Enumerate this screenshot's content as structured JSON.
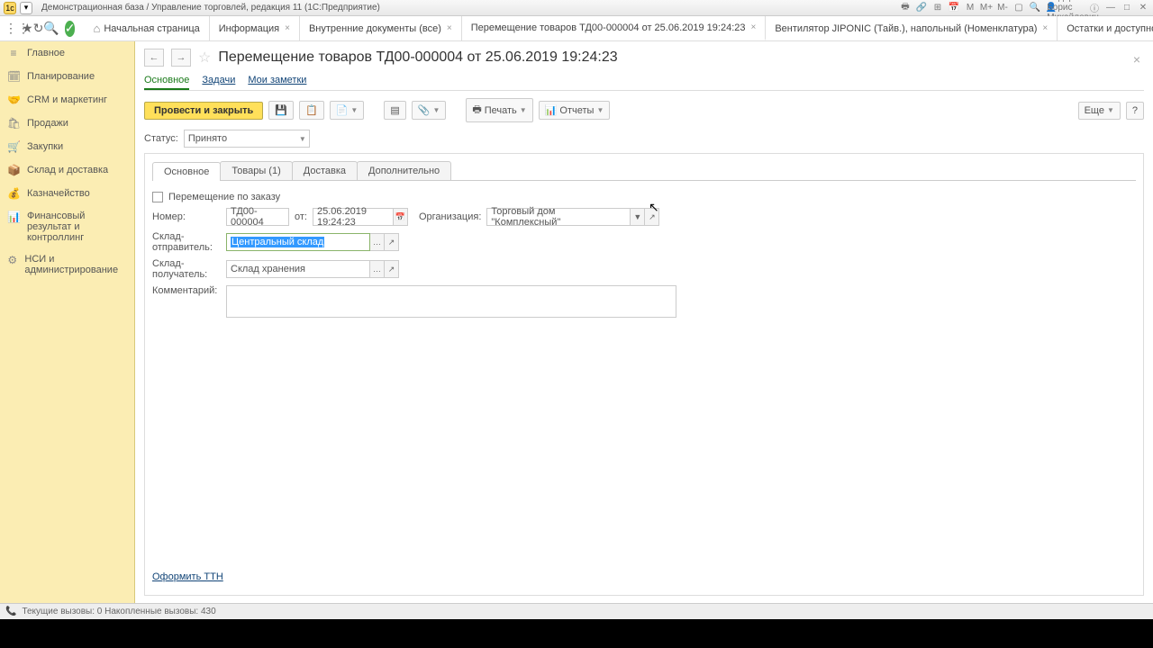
{
  "titlebar": {
    "title": "Демонстрационная база / Управление торговлей, редакция 11  (1С:Предприятие)",
    "user": "Федоров Борис Михайлович"
  },
  "topTabs": {
    "home": "Начальная страница",
    "t1": "Информация",
    "t2": "Внутренние документы (все)",
    "t3": "Перемещение товаров ТД00-000004 от 25.06.2019 19:24:23",
    "t4": "Вентилятор JIPONIC (Тайв.), напольный (Номенклатура)",
    "t5": "Остатки и доступность"
  },
  "sidebar": {
    "i0": "Главное",
    "i1": "Планирование",
    "i2": "CRM и маркетинг",
    "i3": "Продажи",
    "i4": "Закупки",
    "i5": "Склад и доставка",
    "i6": "Казначейство",
    "i7": "Финансовый результат и контроллинг",
    "i8": "НСИ и администрирование"
  },
  "doc": {
    "title": "Перемещение товаров ТД00-000004 от 25.06.2019 19:24:23",
    "tabs": {
      "main": "Основное",
      "tasks": "Задачи",
      "notes": "Мои заметки"
    },
    "actions": {
      "post_close": "Провести и закрыть",
      "print": "Печать",
      "reports": "Отчеты",
      "more": "Еще"
    },
    "status_label": "Статус:",
    "status_value": "Принято",
    "inner_tabs": {
      "t0": "Основное",
      "t1": "Товары (1)",
      "t2": "Доставка",
      "t3": "Дополнительно"
    },
    "form": {
      "by_order": "Перемещение по заказу",
      "number_label": "Номер:",
      "number": "ТД00-000004",
      "from_label": "от:",
      "date": "25.06.2019 19:24:23",
      "org_label": "Организация:",
      "org": "Торговый дом \"Комплексный\"",
      "sender_label": "Склад-отправитель:",
      "sender": "Центральный склад",
      "receiver_label": "Склад-получатель:",
      "receiver": "Склад хранения",
      "comment_label": "Комментарий:"
    },
    "footer_link": "Оформить ТТН"
  },
  "statusbar": {
    "text": "Текущие вызовы: 0   Накопленные вызовы: 430"
  }
}
